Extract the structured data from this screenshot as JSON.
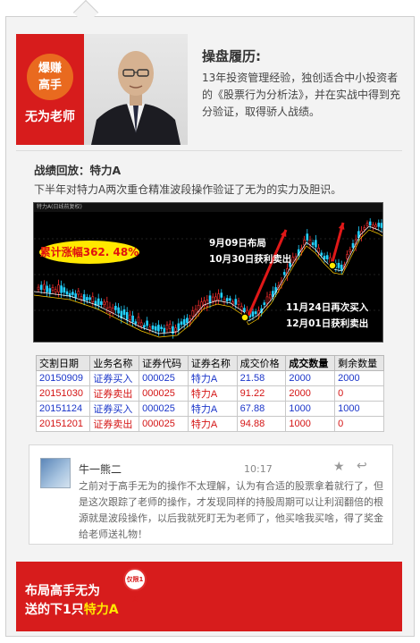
{
  "profile": {
    "badge_line1": "爆赚",
    "badge_line2": "高手",
    "name": "无为老师",
    "bio_title": "操盘履历:",
    "bio_text": "13年投资管理经验，独创适合中小投资者的《股票行为分析法》，并在实战中得到充分验证，取得骄人战绩。"
  },
  "review": {
    "title": "战绩回放：特力A",
    "description": "下半年对特力A两次重仓精准波段操作验证了无为的实力及胆识。"
  },
  "chart_data": {
    "type": "candlestick",
    "header": "特力A(日线前复权)",
    "gain_label": "累计涨幅362. 48%",
    "annotation1_line1": "9月09日布局",
    "annotation1_line2": "10月30日获利卖出",
    "annotation2_line1": "11月24日再次买入",
    "annotation2_line2": "12月01日获利卖出"
  },
  "trade_table": {
    "headers": [
      "交割日期",
      "业务名称",
      "证券代码",
      "证券名称",
      "成交价格",
      "成交数量",
      "剩余数量"
    ],
    "rows": [
      [
        "20150909",
        "证券买入",
        "000025",
        "特力A",
        "21.58",
        "2000",
        "2000"
      ],
      [
        "20151030",
        "证券卖出",
        "000025",
        "特力A",
        "91.22",
        "2000",
        "0"
      ],
      [
        "20151124",
        "证券买入",
        "000025",
        "特力A",
        "67.88",
        "1000",
        "1000"
      ],
      [
        "20151201",
        "证券卖出",
        "000025",
        "特力A",
        "94.88",
        "1000",
        "0"
      ]
    ]
  },
  "comment": {
    "author": "牛一熊二",
    "time": "10:17",
    "text": "之前对于高手无为的操作不太理解，认为有合适的股票拿着就行了，但是这次跟踪了老师的操作，才发现同样的持股周期可以让利润翻倍的根源就是波段操作，以后我就死盯无为老师了，他买啥我买啥，得了奖金给老师送礼物！"
  },
  "footer": {
    "line1": "布局高手无为",
    "line2_prefix": "送的下1只",
    "line2_highlight": "特力A",
    "stamp": "仅限1天"
  },
  "colors": {
    "brand_red": "#d71c1c",
    "badge_orange": "#e96a1f",
    "highlight_yellow": "#ffe800",
    "buy_blue": "#1a35c9",
    "sell_red": "#d41414"
  }
}
